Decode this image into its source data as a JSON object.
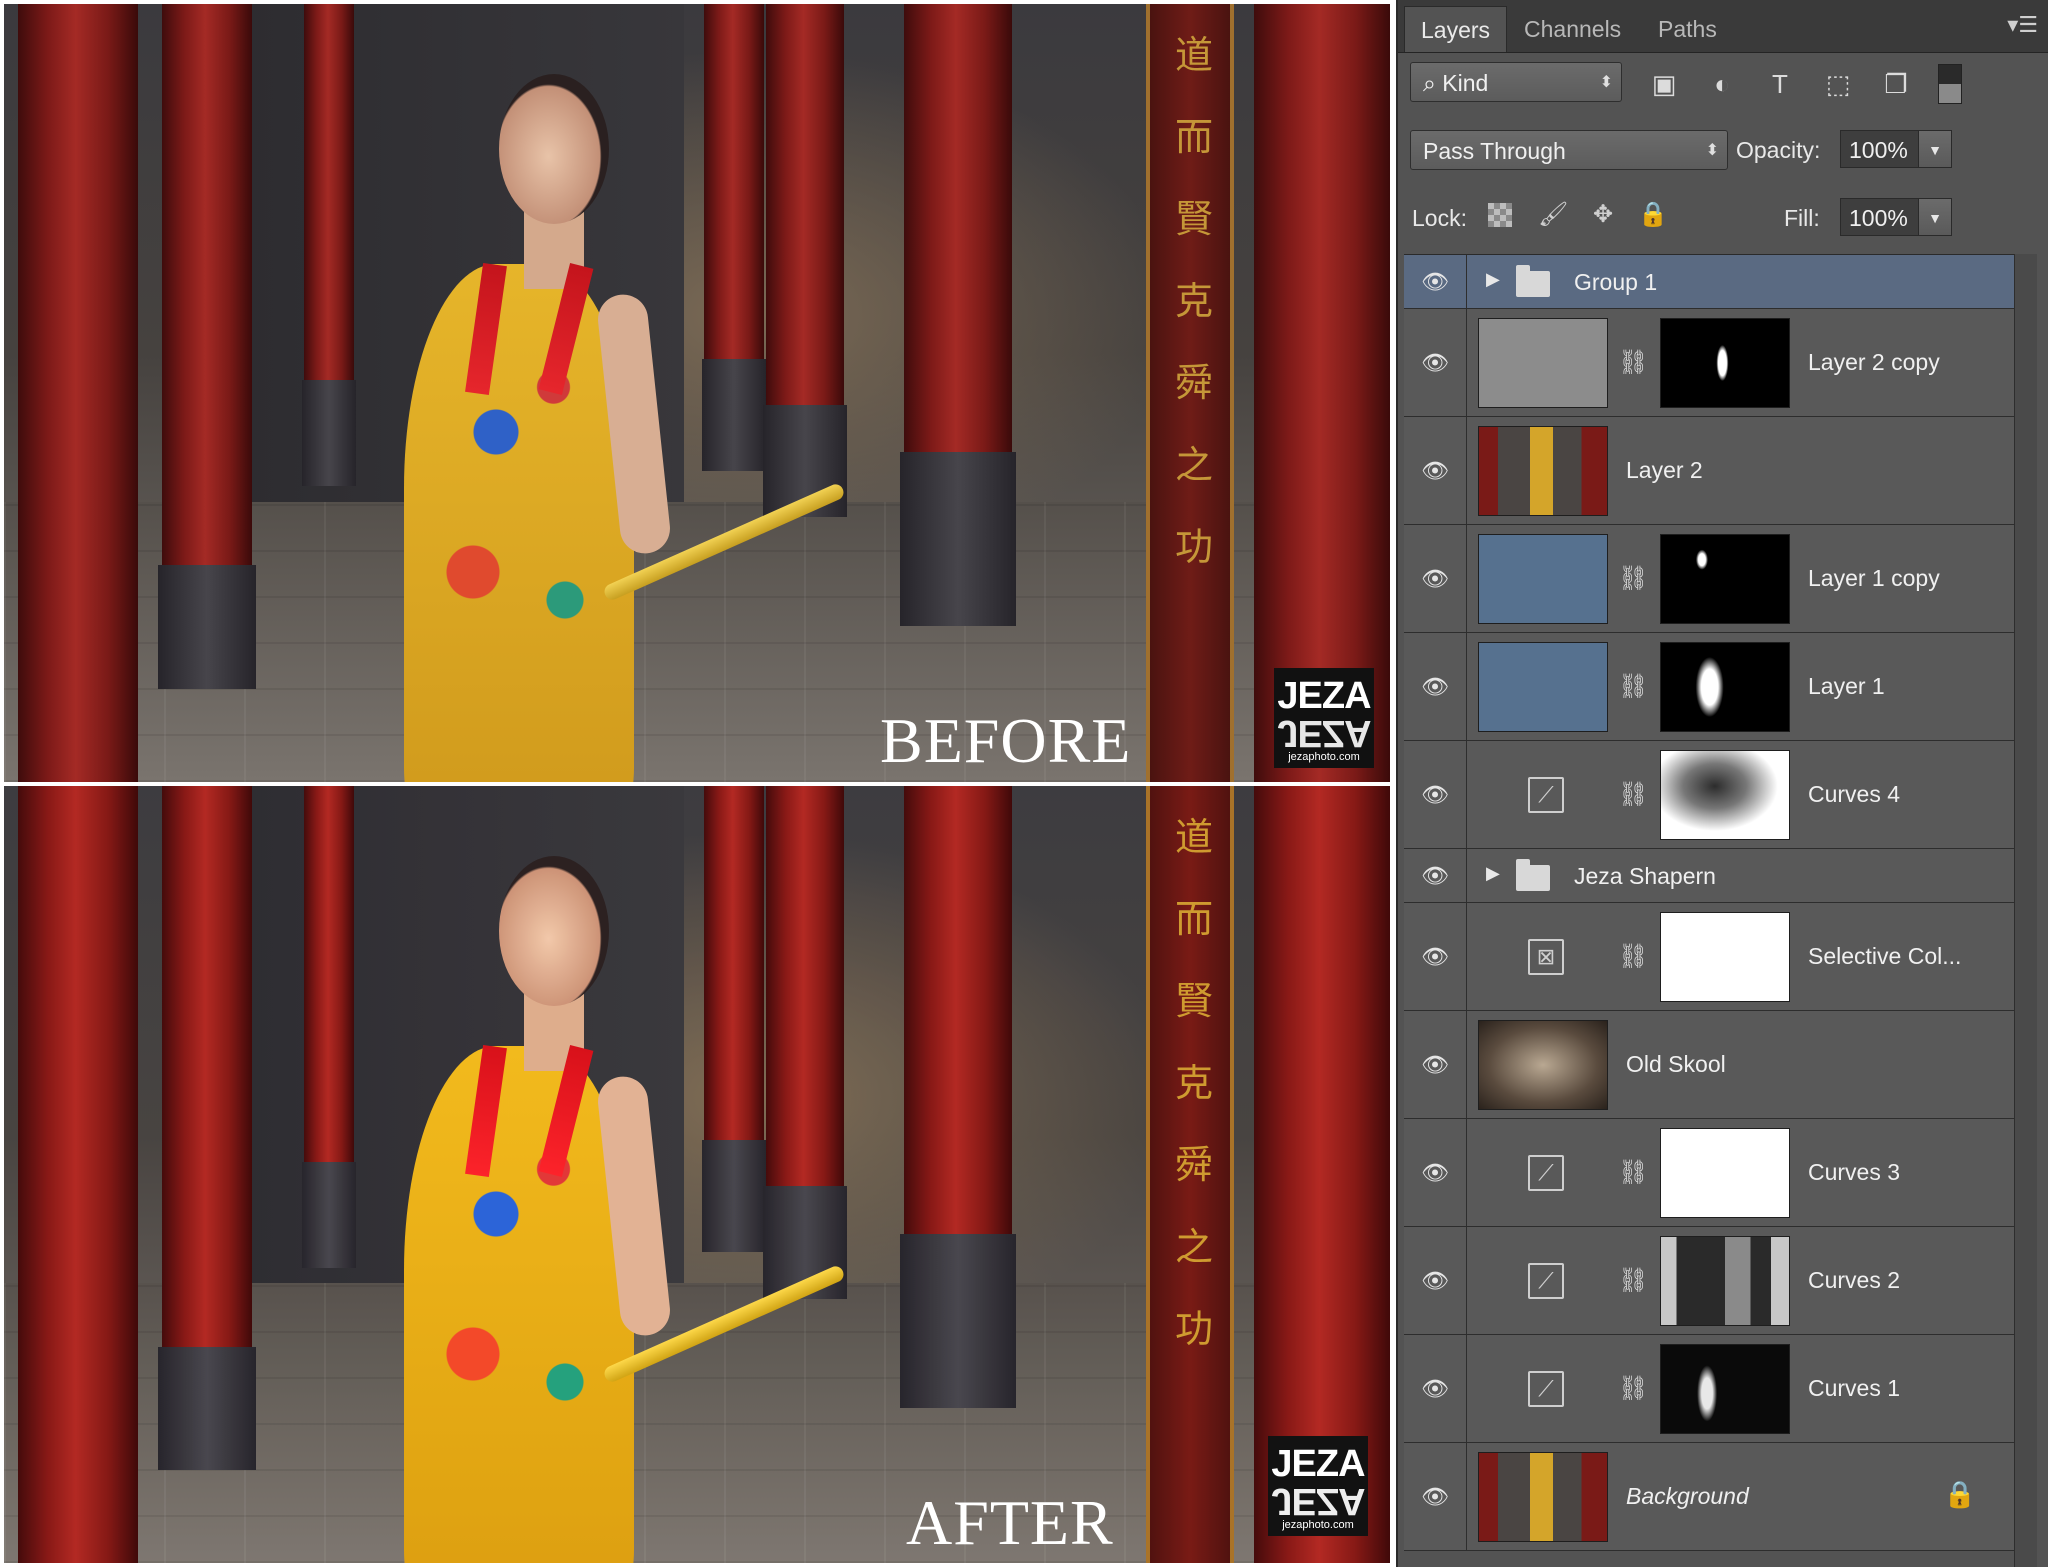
{
  "before_panel": {
    "caption": "BEFORE",
    "logo_text": "JEZA",
    "logo_url": "jezaphoto.com",
    "calligraphy": "道 而 賢 克 舜 之 功"
  },
  "after_panel": {
    "caption": "AFTER",
    "logo_text": "JEZA",
    "logo_url": "jezaphoto.com",
    "calligraphy": "道 而 賢 克 舜 之 功"
  },
  "layers_panel": {
    "tabs": [
      {
        "label": "Layers",
        "active": true
      },
      {
        "label": "Channels",
        "active": false
      },
      {
        "label": "Paths",
        "active": false
      }
    ],
    "menu_icon": "panel-menu-icon",
    "filter": {
      "kind_label": "Kind",
      "icons": [
        "image-filter-icon",
        "adjustment-filter-icon",
        "type-filter-icon",
        "shape-filter-icon",
        "smart-object-filter-icon",
        "filter-toggle-icon"
      ]
    },
    "blend_mode": "Pass Through",
    "opacity_label": "Opacity:",
    "opacity_value": "100%",
    "lock_label": "Lock:",
    "lock_icons": [
      "lock-transparent-icon",
      "lock-image-icon",
      "lock-position-icon",
      "lock-all-icon"
    ],
    "fill_label": "Fill:",
    "fill_value": "100%",
    "layers": [
      {
        "name": "Group 1",
        "type": "group",
        "selected": true
      },
      {
        "name": "Layer 2 copy",
        "type": "pixel-mask",
        "thumb": "gray"
      },
      {
        "name": "Layer 2",
        "type": "pixel",
        "thumb": "photo"
      },
      {
        "name": "Layer 1 copy",
        "type": "pixel-mask",
        "thumb": "blue"
      },
      {
        "name": "Layer 1",
        "type": "pixel-mask",
        "thumb": "blue"
      },
      {
        "name": "Curves 4",
        "type": "adjustment",
        "icon": "curves-icon"
      },
      {
        "name": "Jeza Shapern",
        "type": "group",
        "selected": false
      },
      {
        "name": "Selective Col...",
        "type": "adjustment",
        "icon": "selective-color-icon"
      },
      {
        "name": "Old Skool",
        "type": "pixel",
        "thumb": "sepia"
      },
      {
        "name": "Curves 3",
        "type": "adjustment",
        "icon": "curves-icon"
      },
      {
        "name": "Curves 2",
        "type": "adjustment",
        "icon": "curves-icon"
      },
      {
        "name": "Curves 1",
        "type": "adjustment",
        "icon": "curves-icon"
      },
      {
        "name": "Background",
        "type": "background",
        "thumb": "photo",
        "locked": true
      }
    ]
  }
}
